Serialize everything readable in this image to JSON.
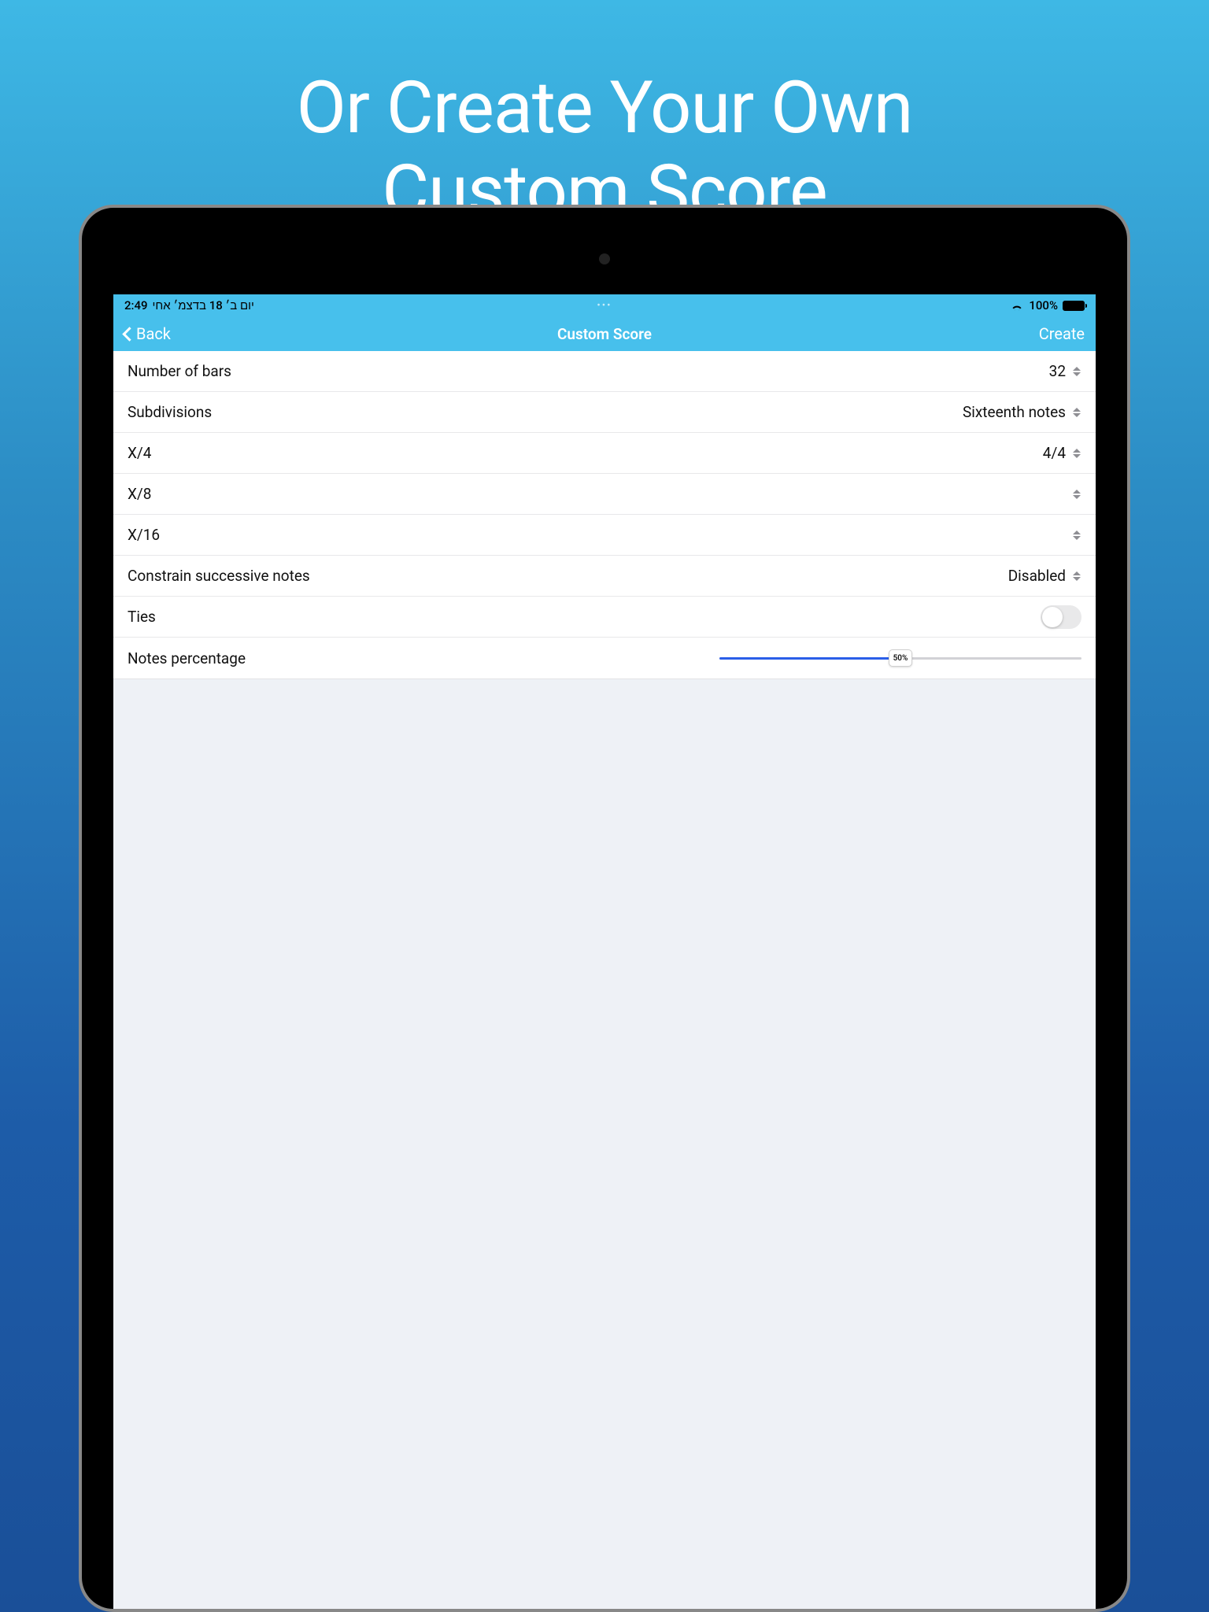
{
  "promo": {
    "line1": "Or Create Your Own",
    "line2": "Custom Score"
  },
  "status": {
    "time": "2:49",
    "date_text": "יום ב׳ 18 בדצמ׳ אחי",
    "center_dots": "•••",
    "battery_percent": "100%"
  },
  "nav": {
    "back_label": "Back",
    "title": "Custom Score",
    "create_label": "Create"
  },
  "rows": {
    "number_of_bars": {
      "label": "Number of bars",
      "value": "32"
    },
    "subdivisions": {
      "label": "Subdivisions",
      "value": "Sixteenth notes"
    },
    "x4": {
      "label": "X/4",
      "value": "4/4"
    },
    "x8": {
      "label": "X/8",
      "value": ""
    },
    "x16": {
      "label": "X/16",
      "value": ""
    },
    "constrain": {
      "label": "Constrain successive notes",
      "value": "Disabled"
    },
    "ties": {
      "label": "Ties"
    },
    "notes_percentage": {
      "label": "Notes percentage",
      "percent": 50,
      "percent_label": "50%"
    }
  }
}
